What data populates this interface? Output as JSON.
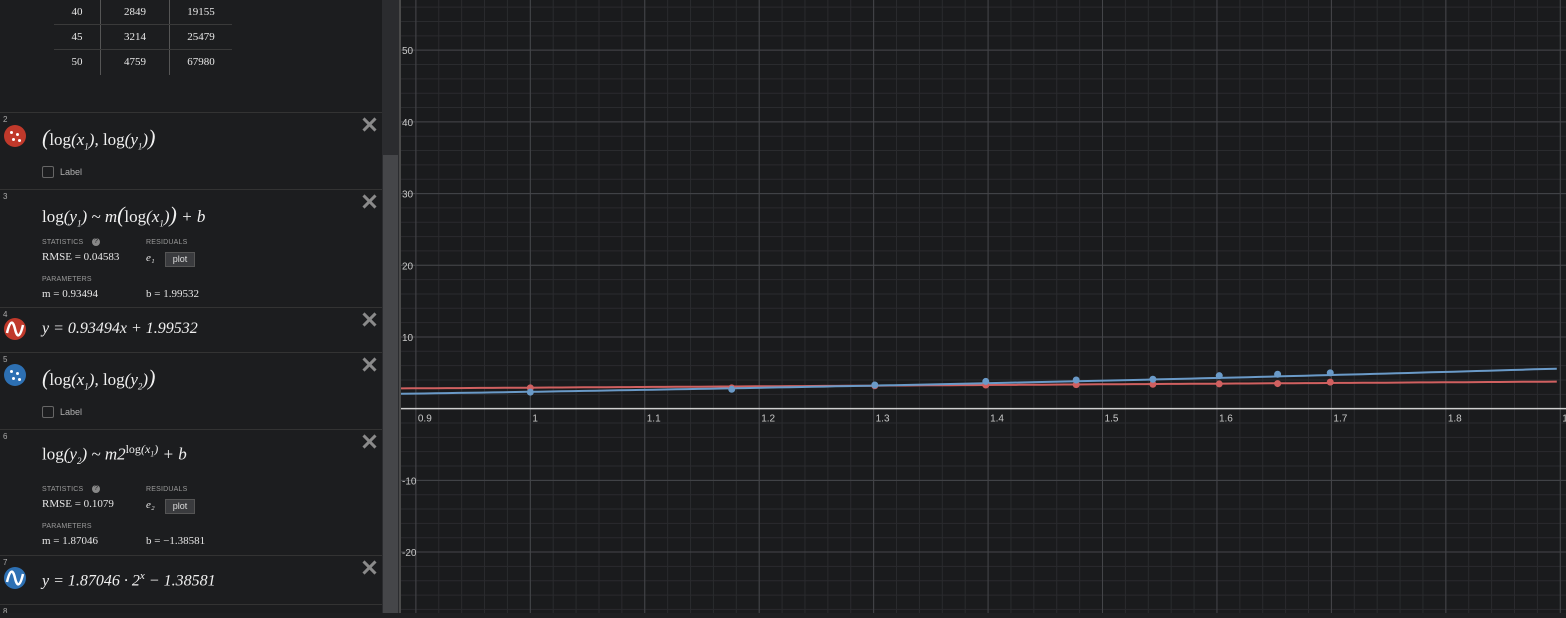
{
  "table": {
    "rows": [
      {
        "x": "40",
        "y1": "2849",
        "y2": "19155"
      },
      {
        "x": "45",
        "y1": "3214",
        "y2": "25479"
      },
      {
        "x": "50",
        "y1": "4759",
        "y2": "67980"
      }
    ]
  },
  "expressions": {
    "e2": {
      "num": "2",
      "label": "Label"
    },
    "e3": {
      "num": "3",
      "stats_cap": "STATISTICS",
      "resid_cap": "RESIDUALS",
      "rmse": "RMSE = 0.04583",
      "resid_var": "e₁",
      "plot": "plot",
      "params_cap": "PARAMETERS",
      "m": "m = 0.93494",
      "b": "b = 1.99532"
    },
    "e4": {
      "num": "4",
      "formula": "y = 0.93494x + 1.99532"
    },
    "e5": {
      "num": "5",
      "label": "Label"
    },
    "e6": {
      "num": "6",
      "stats_cap": "STATISTICS",
      "resid_cap": "RESIDUALS",
      "rmse": "RMSE = 0.1079",
      "resid_var": "e₂",
      "plot": "plot",
      "params_cap": "PARAMETERS",
      "m": "m = 1.87046",
      "b": "b = −1.38581"
    },
    "e7": {
      "num": "7",
      "formula_pre": "y = 1.87046 · 2",
      "formula_sup": "x",
      "formula_post": " − 1.38581"
    },
    "e8": {
      "num": "8"
    }
  },
  "graph": {
    "x_ticks": [
      "0.9",
      "1",
      "1.1",
      "1.2",
      "1.3",
      "1.4",
      "1.5",
      "1.6",
      "1.7",
      "1.8",
      "1"
    ],
    "y_ticks_pos": [
      "10",
      "20",
      "30",
      "40",
      "50"
    ],
    "y_ticks_neg": [
      "-10",
      "-20"
    ]
  },
  "colors": {
    "red": "#c74440",
    "blue": "#2d70b3",
    "red_line": "#d06060",
    "blue_line": "#6a9ac8"
  },
  "chart_data": {
    "type": "scatter",
    "x_range": [
      0.887,
      1.905
    ],
    "y_range": [
      -28.5,
      57
    ],
    "series": [
      {
        "color": "#d06060",
        "points": [
          [
            1.0,
            2.9
          ],
          [
            1.176,
            2.9
          ],
          [
            1.301,
            3.2
          ],
          [
            1.398,
            3.3
          ],
          [
            1.477,
            3.35
          ],
          [
            1.544,
            3.4
          ],
          [
            1.602,
            3.45
          ],
          [
            1.653,
            3.5
          ],
          [
            1.699,
            3.7
          ]
        ],
        "fit_line": {
          "m": 0.93494,
          "b": 1.99532
        }
      },
      {
        "color": "#6a9ac8",
        "points": [
          [
            1.0,
            2.3
          ],
          [
            1.176,
            2.7
          ],
          [
            1.301,
            3.3
          ],
          [
            1.398,
            3.8
          ],
          [
            1.477,
            4.0
          ],
          [
            1.544,
            4.1
          ],
          [
            1.602,
            4.6
          ],
          [
            1.653,
            4.8
          ],
          [
            1.699,
            5.0
          ]
        ],
        "fit_line": {
          "m": 1.87046,
          "b": -1.38581,
          "kind": "exponential"
        }
      }
    ]
  }
}
